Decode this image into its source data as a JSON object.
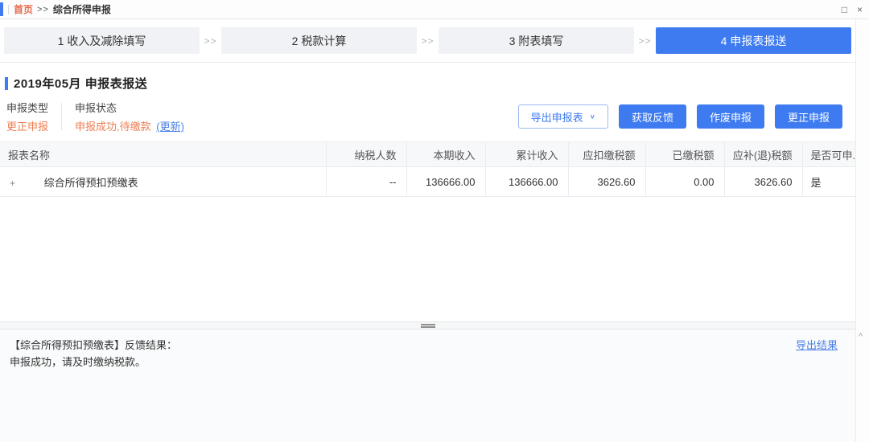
{
  "topbar": {
    "breadcrumb": {
      "home": "首页",
      "separator": ">>",
      "current": "综合所得申报"
    },
    "window": {
      "maximize": "□",
      "close": "×"
    }
  },
  "steps": {
    "arrow": ">>",
    "active_step": 4,
    "items": [
      {
        "label": "1 收入及减除填写"
      },
      {
        "label": "2 税款计算"
      },
      {
        "label": "3 附表填写"
      },
      {
        "label": "4 申报表报送"
      }
    ]
  },
  "section": {
    "title": "2019年05月 申报表报送"
  },
  "status": {
    "type_label": "申报类型",
    "type_value": "更正申报",
    "state_label": "申报状态",
    "state_value": "申报成功,待缴款",
    "update_link": "(更新)"
  },
  "toolbar": {
    "export_button": "导出申报表",
    "export_caret": "∨",
    "feedback_button": "获取反馈",
    "void_button": "作废申报",
    "correct_button": "更正申报"
  },
  "table": {
    "columns": [
      "报表名称",
      "纳税人数",
      "本期收入",
      "累计收入",
      "应扣缴税额",
      "已缴税额",
      "应补(退)税额",
      "是否可申..."
    ],
    "row": {
      "expand_icon": "+",
      "name": "综合所得预扣预缴表",
      "taxpayer_count": "--",
      "current_income": "136666.00",
      "cumulative_income": "136666.00",
      "withholding_tax": "3626.60",
      "paid_tax": "0.00",
      "payable_refund_tax": "3626.60",
      "declarable": "是"
    }
  },
  "footer": {
    "line1": "【综合所得预扣预缴表】反馈结果：",
    "line2": "申报成功，请及时缴纳税款。",
    "export_link": "导出结果",
    "collapse_icon": "^"
  },
  "colors": {
    "accent_blue": "#3e7bf0",
    "orange_text": "#ee7e52",
    "link_blue": "#4a7fe8",
    "success_green": "#33a35c"
  }
}
